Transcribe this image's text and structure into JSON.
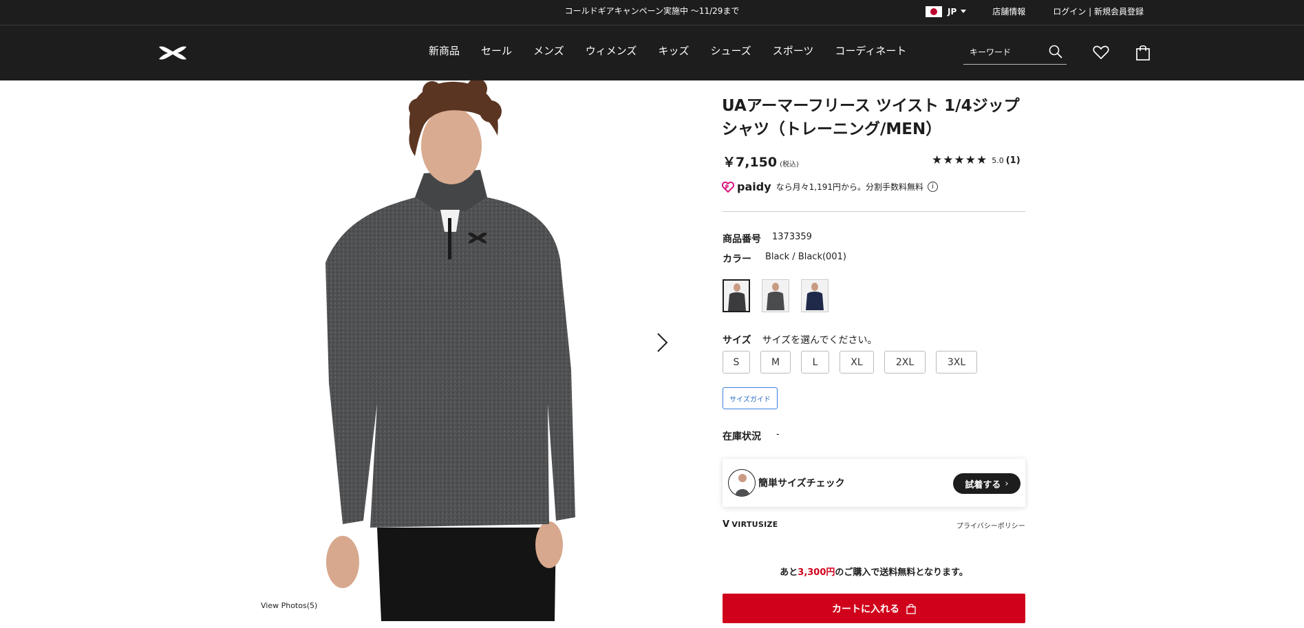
{
  "topbar": {
    "promo": "コールドギアキャンペーン実施中 〜11/29まで",
    "region": "JP",
    "store_link": "店舗情報",
    "login_link": "ログイン | 新規会員登録"
  },
  "header": {
    "logo": "under-armour-logo",
    "nav": [
      "新商品",
      "セール",
      "メンズ",
      "ウィメンズ",
      "キッズ",
      "シューズ",
      "スポーツ",
      "コーディネート"
    ],
    "search_placeholder": "キーワード",
    "icons": [
      "search-icon",
      "heart-icon",
      "bag-icon"
    ]
  },
  "gallery": {
    "view_photos": "View Photos(5)"
  },
  "product": {
    "title": "UAアーマーフリース ツイスト 1/4ジップシャツ（トレーニング/MEN）",
    "price": "￥7,150",
    "tax_note": "(税込)",
    "stars": "★★★★★",
    "rating_score": "5.0",
    "rating_count": "(1)",
    "paidy_brand": "paidy",
    "paidy_text": "なら月々1,191円から。分割手数料無料",
    "sku_label": "商品番号",
    "sku_value": "1373359",
    "color_label": "カラー",
    "color_value": "Black / Black(001)",
    "swatch_colors": [
      "#3b3b3d",
      "#4a4b4d",
      "#1f2a4a"
    ],
    "size_label": "サイズ",
    "size_prompt": "サイズを選んでください。",
    "sizes": [
      "S",
      "M",
      "L",
      "XL",
      "2XL",
      "3XL"
    ],
    "size_guide": "サイズガイド",
    "stock_label": "在庫状況",
    "stock_value": "-",
    "virtusize_title": "簡単サイズチェック",
    "virtusize_try": "試着する",
    "virtusize_brand": "VIRTUSIZE",
    "privacy": "プライバシーポリシー",
    "shipping_pre": "あと",
    "shipping_amount": "3,300円",
    "shipping_post": "のご購入で送料無料となります。",
    "cart_button": "カートに入れる"
  },
  "colors": {
    "header_bg": "#1d1d1d",
    "cart_red": "#d0021b",
    "link_blue": "#2b6cc4"
  }
}
